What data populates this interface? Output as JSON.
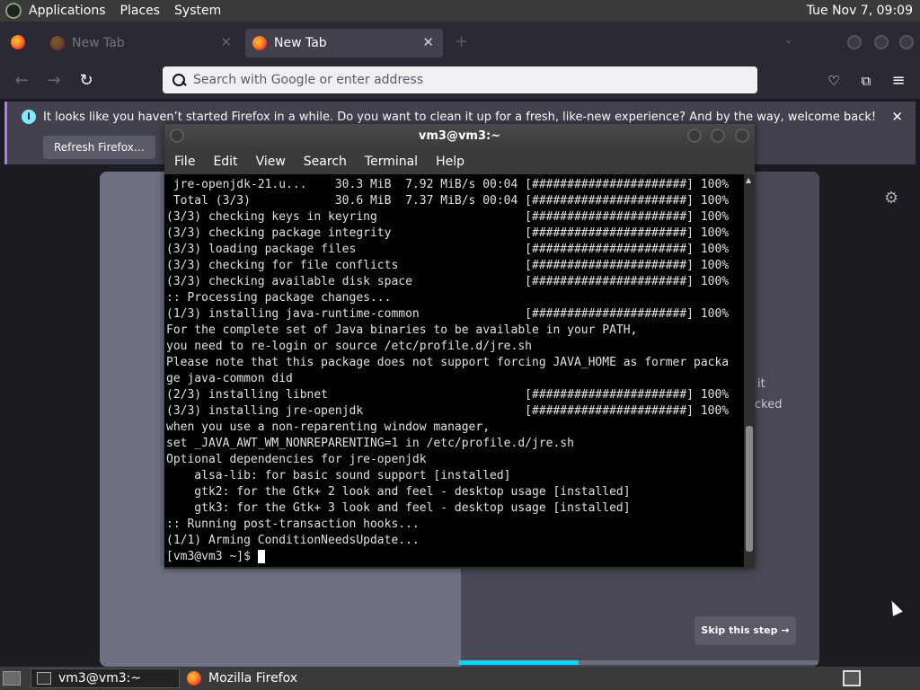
{
  "top_panel": {
    "menus": [
      "Applications",
      "Places",
      "System"
    ],
    "clock": "Tue Nov 7, 09:09"
  },
  "firefox": {
    "tabs": [
      {
        "label": "New Tab",
        "active": false
      },
      {
        "label": "New Tab",
        "active": true
      }
    ],
    "url_placeholder": "Search with Google or enter address",
    "notification": {
      "message": "It looks like you haven’t started Firefox in a while. Do you want to clean it up for a fresh, like-new experience? And by the way, welcome back!",
      "button": "Refresh Firefox…"
    },
    "onboarding": {
      "partial_text_1": "it",
      "partial_text_2": "cked",
      "skip_button": "Skip this step →",
      "progress": 0.33
    }
  },
  "terminal": {
    "title": "vm3@vm3:~",
    "menu": [
      "File",
      "Edit",
      "View",
      "Search",
      "Terminal",
      "Help"
    ],
    "lines": [
      " jre-openjdk-21.u...    30.3 MiB  7.92 MiB/s 00:04 [######################] 100%",
      " Total (3/3)            30.6 MiB  7.37 MiB/s 00:04 [######################] 100%",
      "(3/3) checking keys in keyring                     [######################] 100%",
      "(3/3) checking package integrity                   [######################] 100%",
      "(3/3) loading package files                        [######################] 100%",
      "(3/3) checking for file conflicts                  [######################] 100%",
      "(3/3) checking available disk space                [######################] 100%",
      ":: Processing package changes...",
      "(1/3) installing java-runtime-common               [######################] 100%",
      "For the complete set of Java binaries to be available in your PATH,",
      "you need to re-login or source /etc/profile.d/jre.sh",
      "Please note that this package does not support forcing JAVA_HOME as former packa",
      "ge java-common did",
      "(2/3) installing libnet                            [######################] 100%",
      "(3/3) installing jre-openjdk                       [######################] 100%",
      "when you use a non-reparenting window manager,",
      "set _JAVA_AWT_WM_NONREPARENTING=1 in /etc/profile.d/jre.sh",
      "Optional dependencies for jre-openjdk",
      "    alsa-lib: for basic sound support [installed]",
      "    gtk2: for the Gtk+ 2 look and feel - desktop usage [installed]",
      "    gtk3: for the Gtk+ 3 look and feel - desktop usage [installed]",
      ":: Running post-transaction hooks...",
      "(1/1) Arming ConditionNeedsUpdate..."
    ],
    "prompt": "[vm3@vm3 ~]$ "
  },
  "bottom_panel": {
    "tasks": [
      {
        "label": "vm3@vm3:~",
        "icon": "terminal-icon"
      },
      {
        "label": "Mozilla Firefox",
        "icon": "firefox-icon"
      }
    ]
  }
}
